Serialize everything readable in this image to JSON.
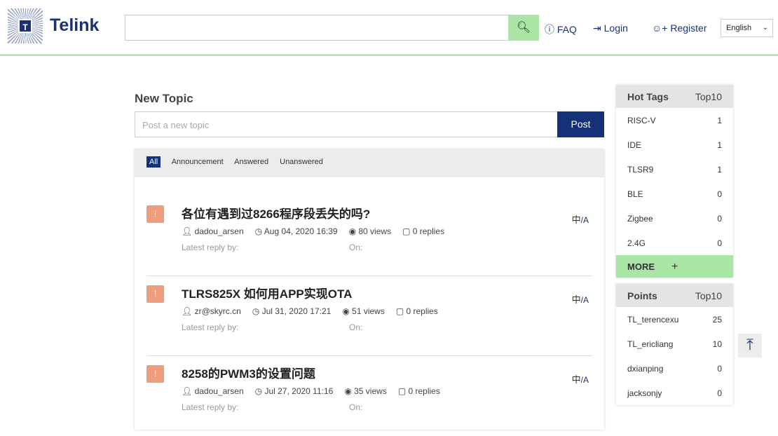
{
  "header": {
    "logo_letter": "T",
    "brand": "Telink",
    "search_placeholder": "",
    "faq": "FAQ",
    "login": "Login",
    "register": "Register",
    "language": "English"
  },
  "new_topic": {
    "title": "New Topic",
    "placeholder": "Post a new topic",
    "post": "Post"
  },
  "filters": [
    "All",
    "Announcement",
    "Answered",
    "Unanswered"
  ],
  "topics": [
    {
      "title": "各位有遇到过8266程序段丢失的吗?",
      "author": "dadou_arsen",
      "date": "Aug 04, 2020 16:39",
      "views": "80 views",
      "replies": "0 replies",
      "latest": "Latest reply by:",
      "on": "On:",
      "lang": "中",
      "lang2": "/A"
    },
    {
      "title": "TLRS825X 如何用APP实现OTA",
      "author": "zr@skyrc.cn",
      "date": "Jul 31, 2020 17:21",
      "views": "51 views",
      "replies": "0 replies",
      "latest": "Latest reply by:",
      "on": "On:",
      "lang": "中",
      "lang2": "/A"
    },
    {
      "title": "8258的PWM3的设置问题",
      "author": "dadou_arsen",
      "date": "Jul 27, 2020 11:16",
      "views": "35 views",
      "replies": "0 replies",
      "latest": "Latest reply by:",
      "on": "On:",
      "lang": "中",
      "lang2": "/A"
    }
  ],
  "hot_tags": {
    "title": "Hot Tags",
    "top": "Top10",
    "items": [
      {
        "name": "RISC-V",
        "count": "1"
      },
      {
        "name": "IDE",
        "count": "1"
      },
      {
        "name": "TLSR9",
        "count": "1"
      },
      {
        "name": "BLE",
        "count": "0"
      },
      {
        "name": "Zigbee",
        "count": "0"
      },
      {
        "name": "2.4G",
        "count": "0"
      }
    ],
    "more": "MORE",
    "plus": "+"
  },
  "points": {
    "title": "Points",
    "top": "Top10",
    "items": [
      {
        "name": "TL_terencexu",
        "count": "25"
      },
      {
        "name": "TL_ericliang",
        "count": "10"
      },
      {
        "name": "dxianping",
        "count": "0"
      },
      {
        "name": "jacksonjy",
        "count": "0"
      }
    ]
  }
}
